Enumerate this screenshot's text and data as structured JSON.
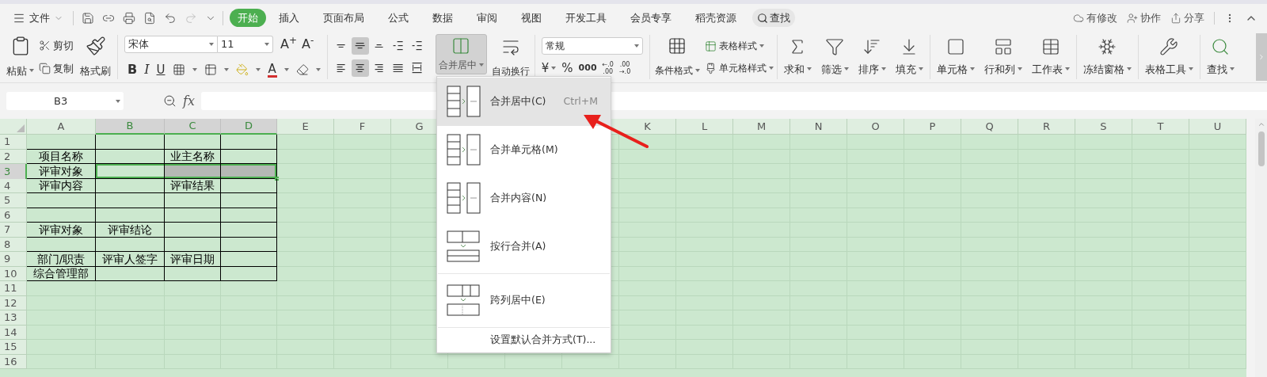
{
  "menu": {
    "file": "文件",
    "tabs": [
      {
        "label": "开始",
        "selected": true
      },
      {
        "label": "插入",
        "selected": false
      },
      {
        "label": "页面布局",
        "selected": false
      },
      {
        "label": "公式",
        "selected": false
      },
      {
        "label": "数据",
        "selected": false
      },
      {
        "label": "审阅",
        "selected": false
      },
      {
        "label": "视图",
        "selected": false
      },
      {
        "label": "开发工具",
        "selected": false
      },
      {
        "label": "会员专享",
        "selected": false
      },
      {
        "label": "稻壳资源",
        "selected": false
      }
    ],
    "search": "查找",
    "actions": [
      {
        "kind": "cloud",
        "label": "有修改"
      },
      {
        "kind": "collab",
        "label": "协作"
      },
      {
        "kind": "share",
        "label": "分享"
      }
    ]
  },
  "ribbon": {
    "clipboard": {
      "paste": "粘贴",
      "cut": "剪切",
      "copy": "复制",
      "painter": "格式刷"
    },
    "font": {
      "name": "宋体",
      "size": "11",
      "grow": "A$^{+}$",
      "shrink": "A$^{-}$",
      "styles": [
        "B",
        "I",
        "U"
      ],
      "color_letter": "A"
    },
    "align": [
      {
        "kind": "top",
        "selected": false
      },
      {
        "kind": "middle",
        "selected": true
      },
      {
        "kind": "bottom",
        "selected": false
      },
      {
        "kind": "indent_dec",
        "selected": false
      },
      {
        "kind": "indent_inc",
        "selected": false
      },
      {
        "kind": "left",
        "selected": false
      },
      {
        "kind": "center",
        "selected": true
      },
      {
        "kind": "right",
        "selected": false
      },
      {
        "kind": "justify",
        "selected": false
      },
      {
        "kind": "distributed",
        "selected": false
      }
    ],
    "merge": {
      "label": "合并居中",
      "selected": true
    },
    "wrap": "自动换行",
    "number": {
      "format": "常规",
      "currency": "¥",
      "percent": "%",
      "thousands": "000",
      "dec_inc": [
        "←.0",
        ".00"
      ],
      "dec_dec": [
        ".00",
        "→.0"
      ]
    },
    "styles": {
      "conditional": "条件格式",
      "table_style": "表格样式",
      "cell_style": "单元格样式"
    },
    "groups": [
      [
        {
          "kind": "sum",
          "label": "求和"
        },
        {
          "kind": "filter",
          "label": "筛选"
        },
        {
          "kind": "sort",
          "label": "排序"
        },
        {
          "kind": "fill",
          "label": "填充"
        }
      ],
      [
        {
          "kind": "cell",
          "label": "单元格"
        },
        {
          "kind": "rowcol",
          "label": "行和列"
        },
        {
          "kind": "sheet",
          "label": "工作表"
        }
      ],
      [
        {
          "kind": "freeze",
          "label": "冻结窗格"
        }
      ],
      [
        {
          "kind": "tools",
          "label": "表格工具"
        }
      ],
      [
        {
          "kind": "find",
          "label": "查找"
        }
      ]
    ]
  },
  "formula_bar": {
    "name_box": "B3",
    "fx": "fx"
  },
  "sheet": {
    "columns": [
      {
        "label": "A",
        "selected": false
      },
      {
        "label": "B",
        "selected": true
      },
      {
        "label": "C",
        "selected": true
      },
      {
        "label": "D",
        "selected": true
      },
      {
        "label": "E",
        "selected": false
      },
      {
        "label": "F",
        "selected": false
      },
      {
        "label": "G",
        "selected": false
      },
      {
        "label": "K",
        "selected": false
      },
      {
        "label": "L",
        "selected": false
      },
      {
        "label": "M",
        "selected": false
      },
      {
        "label": "N",
        "selected": false
      },
      {
        "label": "O",
        "selected": false
      },
      {
        "label": "P",
        "selected": false
      },
      {
        "label": "Q",
        "selected": false
      },
      {
        "label": "R",
        "selected": false
      },
      {
        "label": "S",
        "selected": false
      },
      {
        "label": "T",
        "selected": false
      },
      {
        "label": "U",
        "selected": false
      }
    ],
    "rows": [
      {
        "label": "1",
        "selected": false,
        "cells": [
          null,
          null,
          null,
          null
        ]
      },
      {
        "label": "2",
        "selected": false,
        "cells": [
          "项目名称",
          null,
          "业主名称",
          null
        ]
      },
      {
        "label": "3",
        "selected": true,
        "cells": [
          "评审对象",
          null,
          null,
          null
        ]
      },
      {
        "label": "4",
        "selected": false,
        "cells": [
          "评审内容",
          null,
          "评审结果",
          null
        ]
      },
      {
        "label": "5",
        "selected": false,
        "cells": [
          null,
          null,
          null,
          null
        ]
      },
      {
        "label": "6",
        "selected": false,
        "cells": [
          null,
          null,
          null,
          null
        ]
      },
      {
        "label": "7",
        "selected": false,
        "cells": [
          "评审对象",
          "评审结论",
          null,
          null
        ]
      },
      {
        "label": "8",
        "selected": false,
        "cells": [
          null,
          null,
          null,
          null
        ]
      },
      {
        "label": "9",
        "selected": false,
        "cells": [
          "部门/职责",
          "评审人签字",
          "评审日期",
          null
        ]
      },
      {
        "label": "10",
        "selected": false,
        "cells": [
          "综合管理部",
          null,
          null,
          null
        ]
      },
      {
        "label": "11",
        "selected": false
      },
      {
        "label": "12",
        "selected": false
      },
      {
        "label": "13",
        "selected": false
      },
      {
        "label": "14",
        "selected": false
      },
      {
        "label": "15",
        "selected": false
      },
      {
        "label": "16",
        "selected": false
      }
    ]
  },
  "merge_menu": {
    "items": [
      {
        "kind": "merge_center",
        "label": "合并居中(C)",
        "shortcut": "Ctrl+M",
        "selected": true
      },
      {
        "kind": "merge_cells",
        "label": "合并单元格(M)",
        "selected": false
      },
      {
        "kind": "merge_content",
        "label": "合并内容(N)",
        "selected": false
      },
      {
        "kind": "merge_rows",
        "label": "按行合并(A)",
        "selected": false
      },
      {
        "kind": "span_center",
        "label": "跨列居中(E)",
        "selected": false
      }
    ],
    "footer": "设置默认合并方式(T)..."
  }
}
